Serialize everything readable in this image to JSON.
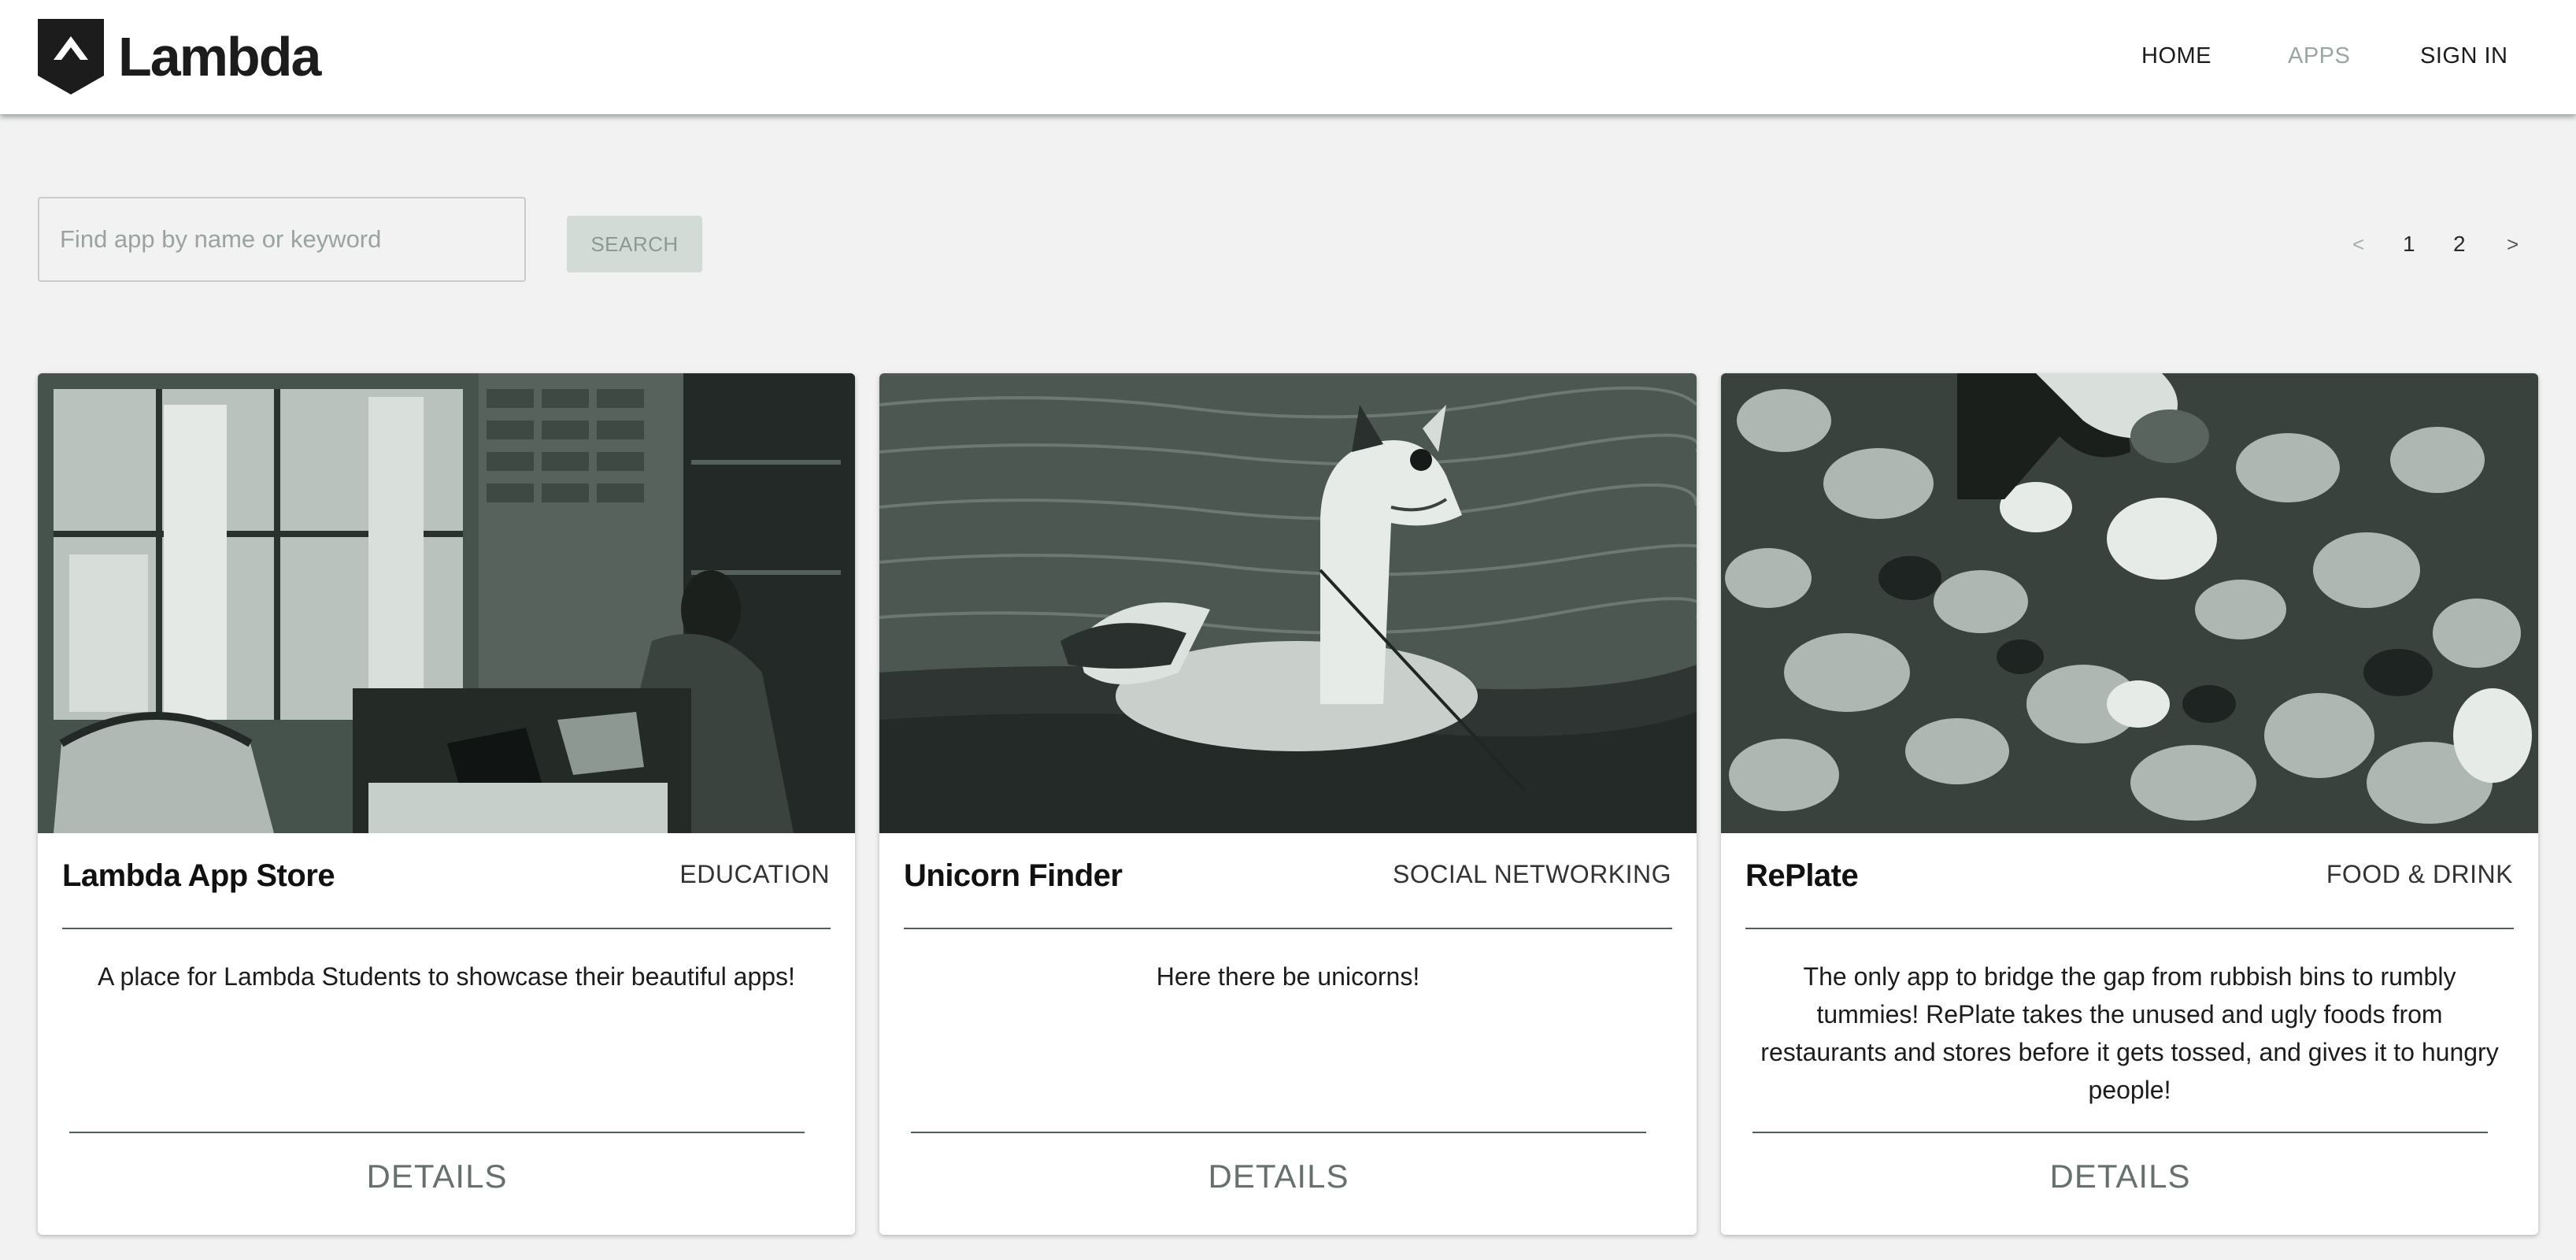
{
  "brand": {
    "name": "Lambda"
  },
  "nav": {
    "home": "HOME",
    "apps": "APPS",
    "signin": "SIGN IN"
  },
  "search": {
    "placeholder": "Find app by name or keyword",
    "value": "",
    "button": "SEARCH"
  },
  "pagination": {
    "prev": "<",
    "pages": [
      "1",
      "2"
    ],
    "next": ">"
  },
  "cards": [
    {
      "title": "Lambda App Store",
      "category": "EDUCATION",
      "description": "A place for Lambda Students to showcase their beautiful apps!",
      "details_label": "DETAILS",
      "image": "cafe-laptop-photo"
    },
    {
      "title": "Unicorn Finder",
      "category": "SOCIAL NETWORKING",
      "description": "Here there be unicorns!",
      "details_label": "DETAILS",
      "image": "inflatable-unicorn-beach-photo"
    },
    {
      "title": "RePlate",
      "category": "FOOD & DRINK",
      "description": "The only app to bridge the gap from rubbish bins to rumbly tummies! RePlate takes the unused and ugly foods from restaurants and stores before it gets tossed, and gives it to hungry people!",
      "details_label": "DETAILS",
      "image": "beach-pebbles-hand-photo"
    }
  ],
  "colors": {
    "background": "#f1f2f1",
    "header": "#ffffff",
    "accent_muted": "#9aa6a1",
    "search_button_bg": "#d3dbd7",
    "rule": "#4f5f5a"
  }
}
